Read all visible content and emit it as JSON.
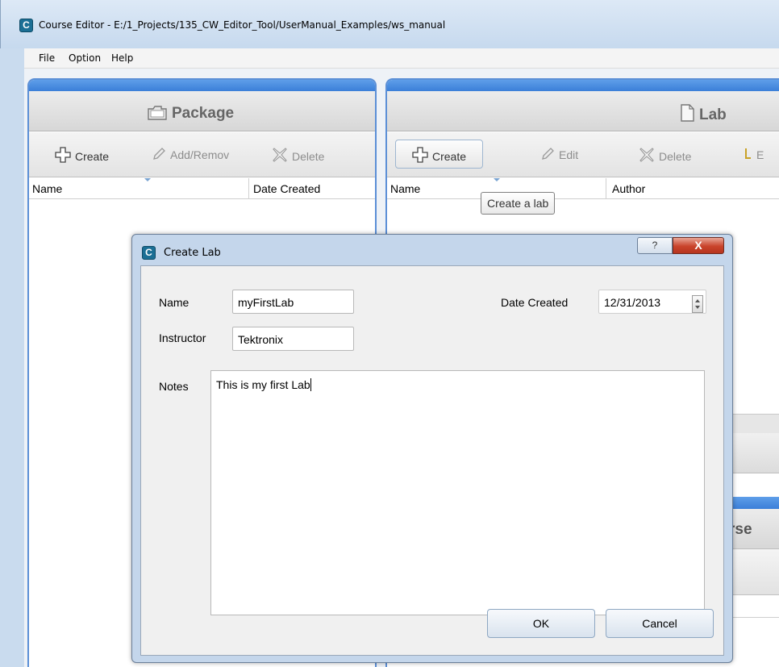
{
  "window": {
    "title": "Course Editor - E:/1_Projects/135_CW_Editor_Tool/UserManual_Examples/ws_manual",
    "icon": "app-logo-icon"
  },
  "menu": {
    "items": [
      "File",
      "Option",
      "Help"
    ]
  },
  "package_panel": {
    "title": "Package",
    "icon": "folder-icon",
    "toolbar": {
      "create": "Create",
      "add_remove": "Add/Remov",
      "delete": "Delete"
    },
    "columns": [
      "Name",
      "Date Created"
    ]
  },
  "lab_panel": {
    "title": "Lab",
    "icon": "document-icon",
    "toolbar": {
      "create": "Create",
      "edit": "Edit",
      "delete": "Delete",
      "fourth_partial": "E"
    },
    "columns": [
      "Name",
      "Author"
    ],
    "tooltip": "Create a lab"
  },
  "background_fragment": {
    "partial_title": "rse"
  },
  "dialog": {
    "title": "Create Lab",
    "help_label": "?",
    "close_label": "X",
    "fields": {
      "name_label": "Name",
      "name_value": "myFirstLab",
      "instructor_label": "Instructor",
      "instructor_value": "Tektronix",
      "date_label": "Date Created",
      "date_value": "12/31/2013",
      "notes_label": "Notes",
      "notes_value": "This is my first Lab"
    },
    "buttons": {
      "ok": "OK",
      "cancel": "Cancel"
    }
  },
  "colors": {
    "panel_accent": "#3b7fd8",
    "close_button": "#c9432b",
    "dialog_frame": "#c4d6eb"
  }
}
